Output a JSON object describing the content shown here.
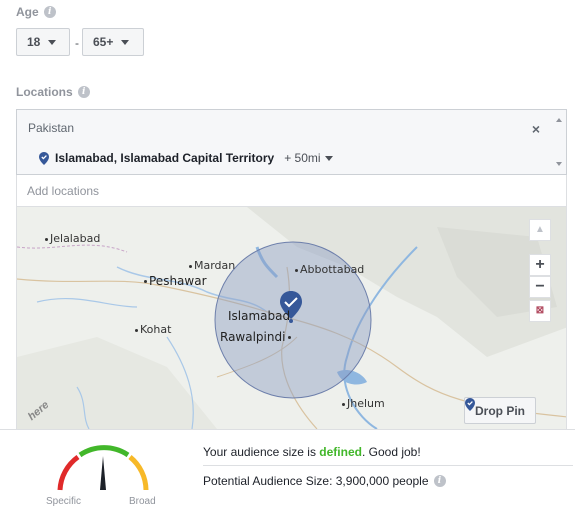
{
  "age": {
    "label": "Age",
    "min_value": "18",
    "max_value": "65+",
    "separator": "-"
  },
  "locations": {
    "label": "Locations",
    "country": "Pakistan",
    "close_symbol": "×",
    "selected": {
      "name": "Islamabad, Islamabad Capital Territory",
      "radius": "+ 50mi"
    },
    "add_placeholder": "Add locations"
  },
  "map": {
    "cities": {
      "jelalabad": "Jelalabad",
      "mardan": "Mardan",
      "abbottabad": "Abbottabad",
      "peshawar": "Peshawar",
      "islamabad": "Islamabad",
      "kohat": "Kohat",
      "rawalpindi": "Rawalpindi",
      "jhelum": "Jhelum"
    },
    "attribution": "here",
    "zoom_in": "+",
    "zoom_out": "−",
    "drop_pin_label": "Drop Pin",
    "circle_color": "#8b9dc3",
    "pin_color": "#365899"
  },
  "audience": {
    "gauge_specific": "Specific",
    "gauge_broad": "Broad",
    "status_prefix": "Your audience size is ",
    "status_word": "defined",
    "status_suffix": ". Good job!",
    "potential": "Potential Audience Size: 3,900,000 people",
    "gauge_colors": {
      "red": "#e02a2a",
      "yellow": "#f7b928",
      "green": "#42b72a"
    }
  }
}
